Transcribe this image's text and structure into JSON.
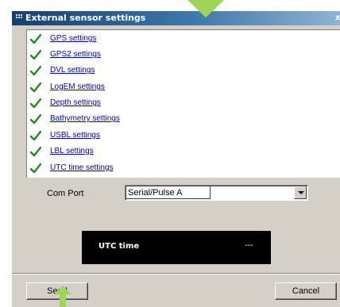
{
  "window": {
    "title": "External sensor settings",
    "close_glyph": "x"
  },
  "checklist": {
    "items": [
      {
        "label": "GPS settings",
        "checked": true
      },
      {
        "label": "GPS2 settings",
        "checked": true
      },
      {
        "label": "DVL settings",
        "checked": true
      },
      {
        "label": "LogEM settings",
        "checked": true
      },
      {
        "label": "Depth settings",
        "checked": true
      },
      {
        "label": "Bathymetry settings",
        "checked": true
      },
      {
        "label": "USBL settings",
        "checked": true
      },
      {
        "label": "LBL settings",
        "checked": true
      },
      {
        "label": "UTC time settings",
        "checked": true
      }
    ],
    "check_icon": "checkmark-icon",
    "check_color": "#1e8c1e"
  },
  "com_port": {
    "label": "Com Port",
    "selected": "Serial/Pulse A"
  },
  "utc": {
    "label": "UTC time",
    "value": "---"
  },
  "buttons": {
    "send": "Send",
    "cancel": "Cancel"
  },
  "markers": {
    "color": "#9ed45a",
    "icons": [
      "pointer-arrow-icon",
      "cursor-arrow-icon"
    ]
  }
}
